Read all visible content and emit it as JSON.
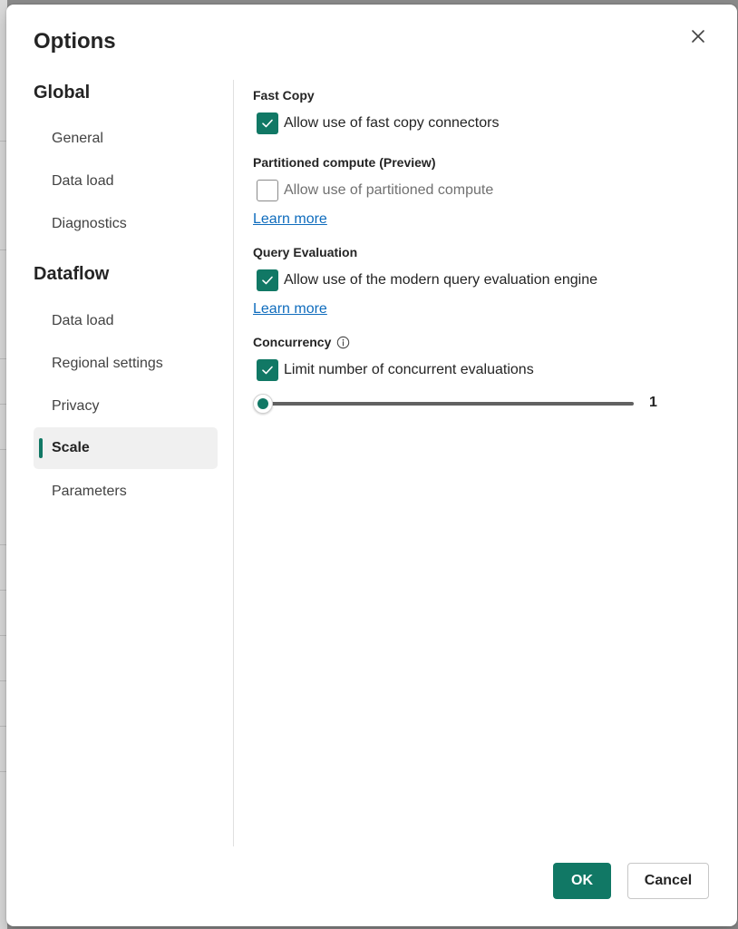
{
  "dialog": {
    "title": "Options",
    "close_icon": "close-icon"
  },
  "nav": {
    "global_heading": "Global",
    "global_items": [
      {
        "label": "General"
      },
      {
        "label": "Data load"
      },
      {
        "label": "Diagnostics"
      }
    ],
    "dataflow_heading": "Dataflow",
    "dataflow_items": [
      {
        "label": "Data load"
      },
      {
        "label": "Regional settings"
      },
      {
        "label": "Privacy"
      },
      {
        "label": "Scale",
        "selected": true
      },
      {
        "label": "Parameters"
      }
    ]
  },
  "content": {
    "fast_copy": {
      "label": "Fast Copy",
      "checkbox_label": "Allow use of fast copy connectors",
      "checked": true
    },
    "partitioned_compute": {
      "label": "Partitioned compute (Preview)",
      "checkbox_label": "Allow use of partitioned compute",
      "checked": false,
      "learn_more": "Learn more"
    },
    "query_evaluation": {
      "label": "Query Evaluation",
      "checkbox_label": "Allow use of the modern query evaluation engine",
      "checked": true,
      "learn_more": "Learn more"
    },
    "concurrency": {
      "label": "Concurrency",
      "info_icon": "info-icon",
      "checkbox_label": "Limit number of concurrent evaluations",
      "checked": true,
      "slider_value": "1"
    }
  },
  "footer": {
    "ok_label": "OK",
    "cancel_label": "Cancel"
  },
  "colors": {
    "accent": "#117865",
    "link": "#0f6cbd"
  }
}
